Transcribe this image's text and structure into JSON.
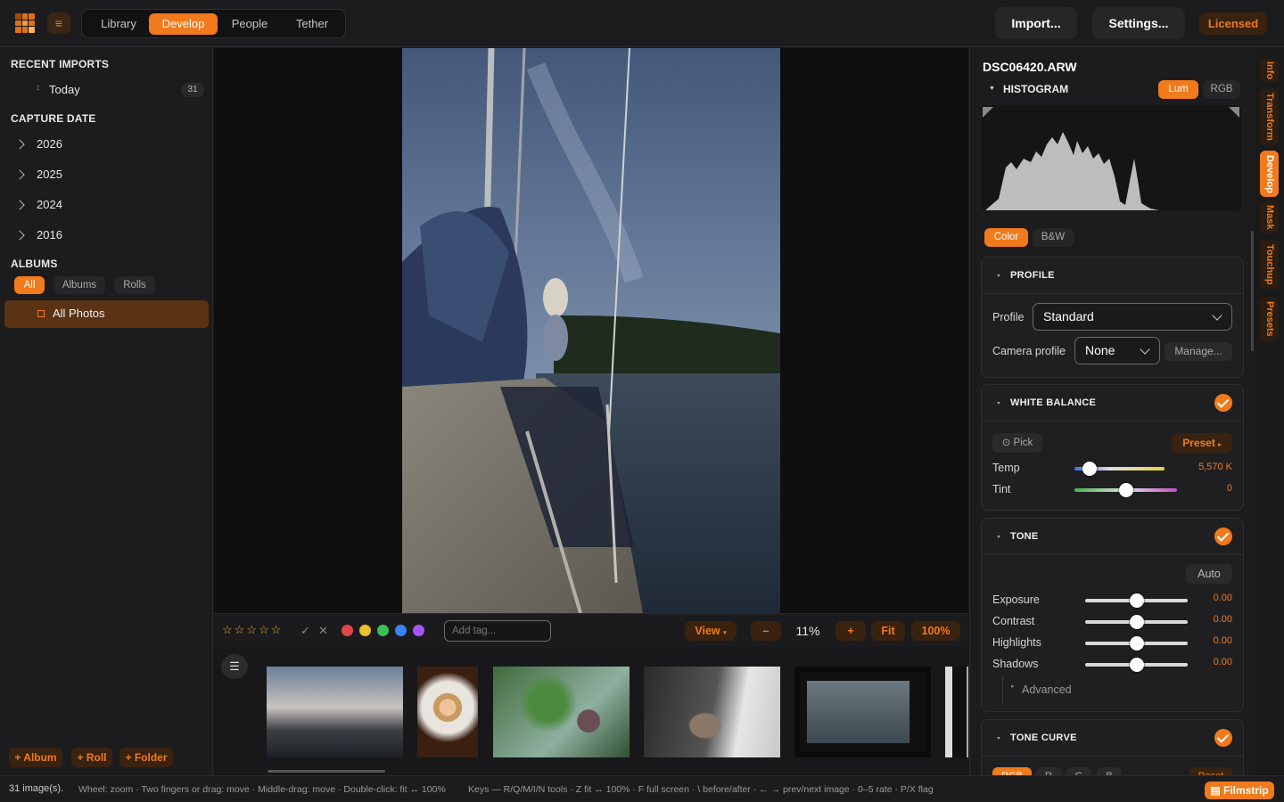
{
  "topbar": {
    "tabs": [
      "Library",
      "Develop",
      "People",
      "Tether"
    ],
    "active_tab": "Develop",
    "import_label": "Import...",
    "settings_label": "Settings...",
    "licensed_label": "Licensed"
  },
  "sidebar": {
    "recent_imports_title": "RECENT IMPORTS",
    "today_label": "Today",
    "today_count": "31",
    "capture_date_title": "CAPTURE DATE",
    "years": [
      "2026",
      "2025",
      "2024",
      "2016"
    ],
    "albums_title": "ALBUMS",
    "album_filters": [
      "All",
      "Albums",
      "Rolls"
    ],
    "all_photos_label": "All Photos",
    "add_album": "+ Album",
    "add_roll": "+ Roll",
    "add_folder": "+ Folder"
  },
  "toolbar": {
    "rating_stars": 5,
    "tag_placeholder": "Add tag...",
    "view_label": "View",
    "zoom_minus": "–",
    "zoom_value": "11%",
    "zoom_plus": "+",
    "fit_label": "Fit",
    "full_label": "100%",
    "color_labels": [
      "#e04848",
      "#e8c030",
      "#3cc058",
      "#3b82f6",
      "#a855f7"
    ]
  },
  "right_panel": {
    "filename": "DSC06420.ARW",
    "histogram_title": "HISTOGRAM",
    "hist_modes": [
      "Lum",
      "RGB"
    ],
    "color_modes": [
      "Color",
      "B&W"
    ],
    "profile": {
      "title": "PROFILE",
      "profile_label": "Profile",
      "profile_value": "Standard",
      "camera_profile_label": "Camera profile",
      "camera_profile_value": "None",
      "manage_label": "Manage..."
    },
    "white_balance": {
      "title": "WHITE BALANCE",
      "pick_label": "⊙ Pick",
      "preset_label": "Preset",
      "temp_label": "Temp",
      "temp_value": "5,570 K",
      "temp_level": 0.17,
      "tint_label": "Tint",
      "tint_value": "0",
      "tint_level": 0.5
    },
    "tone": {
      "title": "TONE",
      "auto_label": "Auto",
      "rows": [
        {
          "label": "Exposure",
          "value": "0.00",
          "level": 0.5
        },
        {
          "label": "Contrast",
          "value": "0.00",
          "level": 0.5
        },
        {
          "label": "Highlights",
          "value": "0.00",
          "level": 0.5
        },
        {
          "label": "Shadows",
          "value": "0.00",
          "level": 0.5
        }
      ],
      "advanced_label": "Advanced"
    },
    "tone_curve": {
      "title": "TONE CURVE",
      "channels": [
        "RGB",
        "R",
        "G",
        "B"
      ],
      "reset_label": "Reset"
    }
  },
  "right_tabs": [
    "Info",
    "Transform",
    "Develop",
    "Mask",
    "Touchup",
    "Presets"
  ],
  "active_right_tab": "Develop",
  "status": {
    "count": "31 image(s).",
    "hints": "Wheel: zoom · Two fingers or drag: move · Middle-drag: move · Double-click: fit ↔ 100%",
    "keys": "Keys — R/Q/M/I/N tools · Z fit ↔ 100% · F full screen · \\ before/after · ← → prev/next image · 0–5 rate · P/X flag",
    "filmstrip_label": "Filmstrip"
  },
  "colors": {
    "accent": "#f07a1c",
    "bg": "#1a1a1b"
  }
}
